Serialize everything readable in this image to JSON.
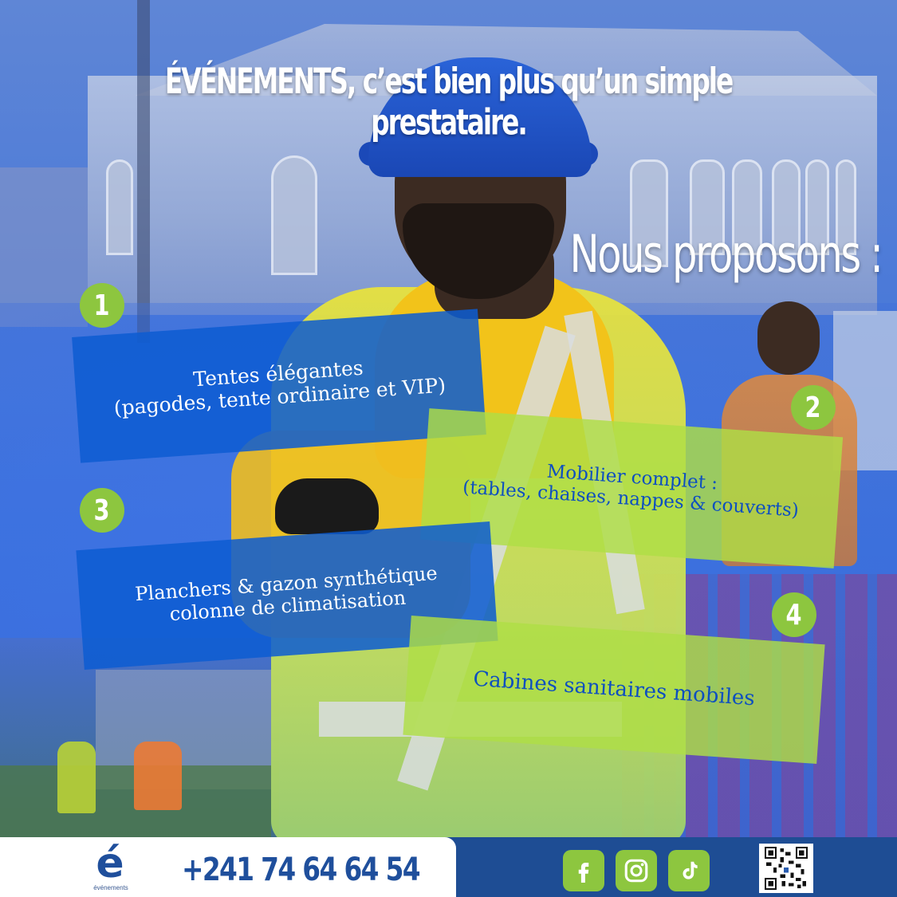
{
  "headline": "ÉVÉNEMENTS, c’est bien plus qu’un simple prestataire.",
  "subheadline": "Nous proposons :",
  "offers": [
    {
      "number": "1",
      "text": "Tentes élégantes\n(pagodes, tente  ordinaire et VIP)"
    },
    {
      "number": "2",
      "text": "Mobilier complet :\n(tables, chaises, nappes & couverts)"
    },
    {
      "number": "3",
      "text": "Planchers & gazon synthétique\ncolonne de climatisation"
    },
    {
      "number": "4",
      "text": "Cabines sanitaires mobiles"
    }
  ],
  "footer": {
    "logo_letter": "é",
    "logo_caption": "événements",
    "phone": "+241 74 64 64 54",
    "socials": [
      "facebook-icon",
      "instagram-icon",
      "tiktok-icon"
    ]
  },
  "colors": {
    "blue_card": "#0d5cd2",
    "green_card": "#afde46",
    "badge_green": "#8dc63f",
    "footer_blue": "#1e4d94"
  }
}
